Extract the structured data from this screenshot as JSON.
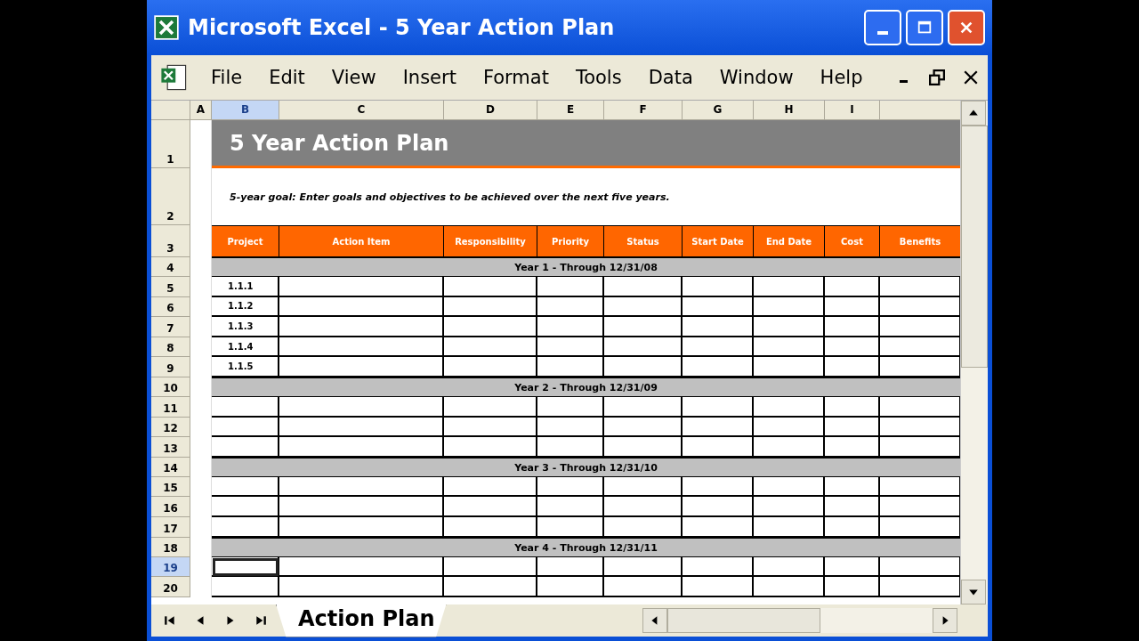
{
  "window": {
    "title": "Microsoft Excel - 5 Year Action Plan"
  },
  "menu": [
    "File",
    "Edit",
    "View",
    "Insert",
    "Format",
    "Tools",
    "Data",
    "Window",
    "Help"
  ],
  "columns": [
    {
      "label": "A",
      "selected": false
    },
    {
      "label": "B",
      "selected": true
    },
    {
      "label": "C",
      "selected": false
    },
    {
      "label": "D",
      "selected": false
    },
    {
      "label": "E",
      "selected": false
    },
    {
      "label": "F",
      "selected": false
    },
    {
      "label": "G",
      "selected": false
    },
    {
      "label": "H",
      "selected": false
    },
    {
      "label": "I",
      "selected": false
    }
  ],
  "rows": [
    {
      "number": "1",
      "kind": "title",
      "text": "5 Year Action Plan",
      "selected": false
    },
    {
      "number": "2",
      "kind": "note",
      "text": "5-year goal: Enter goals and objectives to be achieved over the next five years.",
      "selected": false
    },
    {
      "number": "3",
      "kind": "header",
      "cells": [
        "Project",
        "Action Item",
        "Responsibility",
        "Priority",
        "Status",
        "Start Date",
        "End Date",
        "Cost",
        "Benefits"
      ],
      "selected": false
    },
    {
      "number": "4",
      "kind": "section",
      "text": "Year 1 - Through 12/31/08",
      "selected": false
    },
    {
      "number": "5",
      "kind": "data",
      "item": "1.1.1",
      "selected": false
    },
    {
      "number": "6",
      "kind": "data",
      "item": "1.1.2",
      "selected": false
    },
    {
      "number": "7",
      "kind": "data",
      "item": "1.1.3",
      "selected": false
    },
    {
      "number": "8",
      "kind": "data",
      "item": "1.1.4",
      "selected": false
    },
    {
      "number": "9",
      "kind": "data",
      "item": "1.1.5",
      "selected": false
    },
    {
      "number": "10",
      "kind": "section",
      "text": "Year 2 - Through 12/31/09",
      "selected": false
    },
    {
      "number": "11",
      "kind": "data",
      "selected": false
    },
    {
      "number": "12",
      "kind": "data",
      "selected": false
    },
    {
      "number": "13",
      "kind": "data",
      "selected": false
    },
    {
      "number": "14",
      "kind": "section",
      "text": "Year 3 - Through 12/31/10",
      "selected": false
    },
    {
      "number": "15",
      "kind": "data",
      "selected": false
    },
    {
      "number": "16",
      "kind": "data",
      "selected": false
    },
    {
      "number": "17",
      "kind": "data",
      "selected": false
    },
    {
      "number": "18",
      "kind": "section",
      "text": "Year 4 - Through 12/31/11",
      "selected": false
    },
    {
      "number": "19",
      "kind": "data",
      "selected": true
    },
    {
      "number": "20",
      "kind": "data",
      "selected": false
    }
  ],
  "sheet_tabs": [
    {
      "label": "Action Plan",
      "selected": true
    }
  ]
}
